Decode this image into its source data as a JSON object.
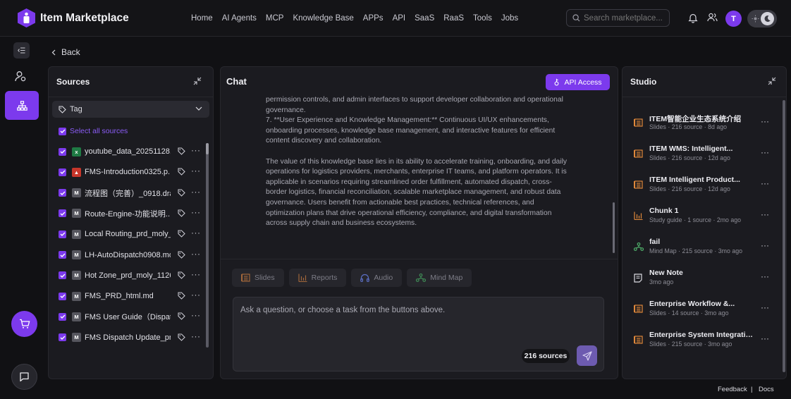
{
  "header": {
    "brand": "Item Marketplace",
    "nav": [
      "Home",
      "AI Agents",
      "MCP",
      "Knowledge Base",
      "APPs",
      "API",
      "SaaS",
      "RaaS",
      "Tools",
      "Jobs"
    ],
    "search_placeholder": "Search marketplace...",
    "avatar_initial": "T",
    "accent": "#7c3aed"
  },
  "back_label": "Back",
  "sources": {
    "title": "Sources",
    "tag_label": "Tag",
    "select_all": "Select all sources",
    "items": [
      {
        "name": "youtube_data_20251128....",
        "type": "xlsx",
        "icon": "excel-icon"
      },
      {
        "name": "FMS-Introduction0325.p...",
        "type": "pdf",
        "icon": "pdf-icon"
      },
      {
        "name": "流程图（完善）_0918.dra...",
        "type": "md",
        "icon": "markdown-icon"
      },
      {
        "name": "Route-Engine-功能说明...",
        "type": "md",
        "icon": "markdown-icon"
      },
      {
        "name": "Local Routing_prd_moly_...",
        "type": "md",
        "icon": "markdown-icon"
      },
      {
        "name": "LH-AutoDispatch0908.md",
        "type": "md",
        "icon": "markdown-icon"
      },
      {
        "name": "Hot Zone_prd_moly_1126...",
        "type": "md",
        "icon": "markdown-icon"
      },
      {
        "name": "FMS_PRD_html.md",
        "type": "md",
        "icon": "markdown-icon"
      },
      {
        "name": "FMS User Guide（Dispat...",
        "type": "md",
        "icon": "markdown-icon"
      },
      {
        "name": "FMS Dispatch Update_pr...",
        "type": "md",
        "icon": "markdown-icon"
      }
    ]
  },
  "chat": {
    "title": "Chat",
    "api_button": "API Access",
    "lines": [
      "permission controls, and admin interfaces to support developer collaboration and operational",
      "governance.",
      "7. **User Experience and Knowledge Management:** Continuous UI/UX enhancements,",
      "onboarding processes, knowledge base management, and interactive features for efficient",
      "content discovery and collaboration.",
      "",
      "The value of this knowledge base lies in its ability to accelerate training, onboarding, and daily",
      "operations for logistics providers, merchants, enterprise IT teams, and platform operators. It is",
      "applicable in scenarios requiring streamlined order fulfillment, automated dispatch, cross-",
      "border logistics, financial reconciliation, scalable marketplace management, and robust data",
      "governance. Users benefit from actionable best practices, technical references, and",
      "optimization plans that drive operational efficiency, compliance, and digital transformation",
      "across supply chain and business ecosystems."
    ],
    "tools": [
      "Slides",
      "Reports",
      "Audio",
      "Mind Map"
    ],
    "input_placeholder": "Ask a question, or choose a task from the buttons above.",
    "sources_badge": "216 sources"
  },
  "studio": {
    "title": "Studio",
    "items": [
      {
        "title": "ITEM智能企业生态系统介绍",
        "meta": "Slides · 216 source · 8d ago",
        "icon": "slides-icon"
      },
      {
        "title": "ITEM WMS: Intelligent...",
        "meta": "Slides · 216 source · 12d ago",
        "icon": "slides-icon"
      },
      {
        "title": "ITEM Intelligent Product...",
        "meta": "Slides · 216 source · 12d ago",
        "icon": "slides-icon"
      },
      {
        "title": "Chunk 1",
        "meta": "Study guide · 1 source · 2mo ago",
        "icon": "report-icon"
      },
      {
        "title": "fail",
        "meta": "Mind Map · 215 source · 3mo ago",
        "icon": "mindmap-icon"
      },
      {
        "title": "New Note",
        "meta": "3mo ago",
        "icon": "note-icon"
      },
      {
        "title": "Enterprise Workflow &...",
        "meta": "Slides · 14 source · 3mo ago",
        "icon": "slides-icon"
      },
      {
        "title": "Enterprise System Integration ...",
        "meta": "Slides · 215 source · 3mo ago",
        "icon": "slides-icon"
      }
    ]
  },
  "footer": {
    "feedback": "Feedback",
    "separator": "|",
    "docs": "Docs"
  }
}
